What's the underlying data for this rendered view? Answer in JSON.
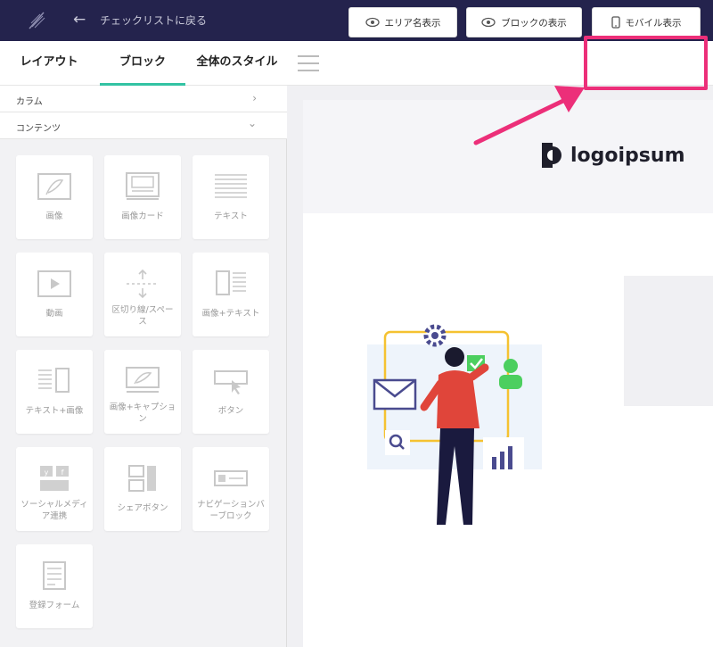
{
  "topbar": {
    "back_label": "チェックリストに戻る",
    "brand_icon": "feather-logo-icon"
  },
  "tabs": [
    {
      "label": "レイアウト",
      "active": false
    },
    {
      "label": "ブロック",
      "active": true
    },
    {
      "label": "全体のスタイル",
      "active": false
    }
  ],
  "toolbar": {
    "area_label": "エリア名表示",
    "block_label": "ブロックの表示",
    "mobile_label": "モバイル表示"
  },
  "sidebar": {
    "sections": [
      {
        "label": "カラム",
        "arrow": "›"
      },
      {
        "label": "コンテンツ",
        "arrow": "⌄"
      }
    ],
    "tiles": [
      {
        "label": "画像",
        "icon": "image-icon"
      },
      {
        "label": "画像カード",
        "icon": "image-card-icon"
      },
      {
        "label": "テキスト",
        "icon": "text-icon"
      },
      {
        "label": "動画",
        "icon": "video-icon"
      },
      {
        "label": "区切り線/スペース",
        "icon": "divider-icon"
      },
      {
        "label": "画像+テキスト",
        "icon": "image-text-icon"
      },
      {
        "label": "テキスト+画像",
        "icon": "text-image-icon"
      },
      {
        "label": "画像+キャプション",
        "icon": "image-caption-icon"
      },
      {
        "label": "ボタン",
        "icon": "button-icon"
      },
      {
        "label": "ソーシャルメディア連携",
        "icon": "social-icon"
      },
      {
        "label": "シェアボタン",
        "icon": "share-icon"
      },
      {
        "label": "ナビゲーションバーブロック",
        "icon": "navbar-icon"
      },
      {
        "label": "登録フォーム",
        "icon": "form-icon"
      }
    ]
  },
  "canvas": {
    "logo_text": "logoipsum"
  },
  "colors": {
    "topbar": "#24234d",
    "accent": "#33c3a3",
    "highlight": "#ec2f79"
  }
}
